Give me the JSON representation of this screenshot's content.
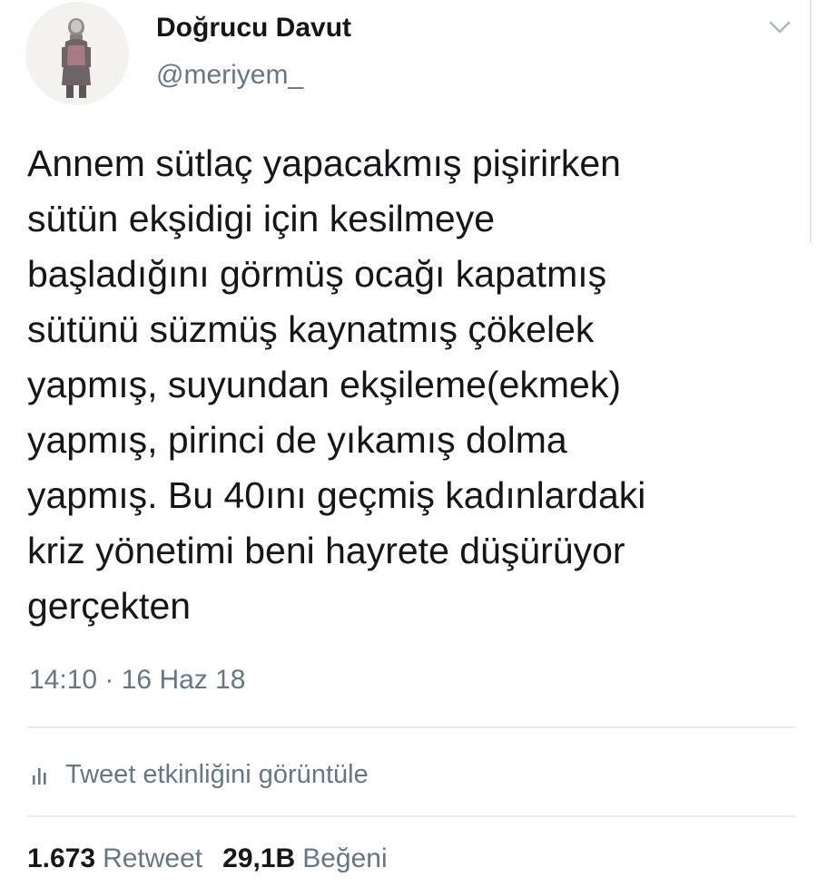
{
  "author": {
    "display_name": "Doğrucu Davut",
    "handle": "@meriyem_"
  },
  "tweet": {
    "lines": [
      "Annem sütlaç yapacakmış pişirirken",
      "sütün ekşidigi için kesilmeye",
      "başladığını görmüş ocağı kapatmış",
      "sütünü süzmüş kaynatmış çökelek",
      "yapmış, suyundan ekşileme(ekmek)",
      "yapmış, pirinci de yıkamış dolma",
      "yapmış. Bu 40ını geçmiş kadınlardaki",
      "kriz yönetimi beni hayrete düşürüyor",
      "gerçekten"
    ],
    "timestamp": "14:10 · 16 Haz 18"
  },
  "analytics": {
    "label": "Tweet etkinliğini görüntüle",
    "icon": "bar-chart-icon"
  },
  "stats": {
    "retweet_count": "1.673",
    "retweet_label": "Retweet",
    "like_count": "29,1B",
    "like_label": "Beğeni"
  },
  "icons": {
    "menu": "chevron-down-icon",
    "avatar": "avatar"
  },
  "colors": {
    "text": "#14171a",
    "secondary": "#657786",
    "divider": "#e6ecf0"
  }
}
